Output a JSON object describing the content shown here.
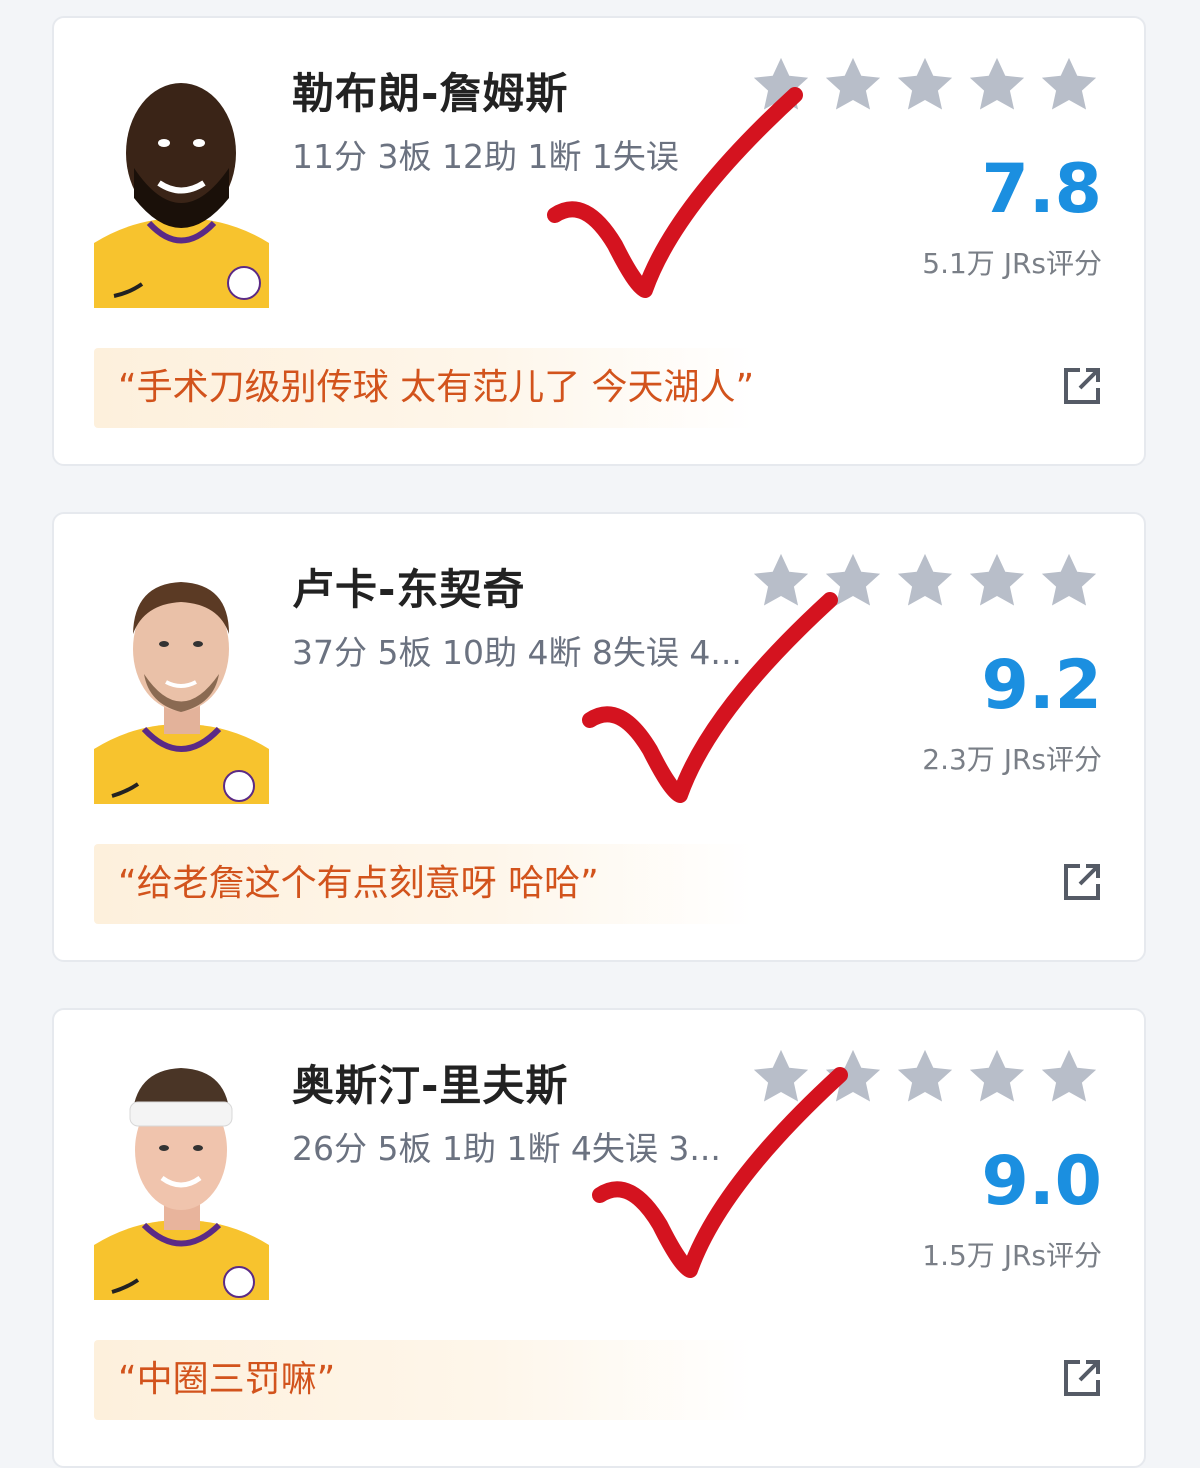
{
  "players": [
    {
      "name": "勒布朗-詹姆斯",
      "stats": "11分 3板 12助 1断 1失误",
      "score": "7.8",
      "rating_count": "5.1万 JRs评分",
      "comment": "“手术刀级别传球 太有范儿了 今天湖人”"
    },
    {
      "name": "卢卡-东契奇",
      "stats": "37分 5板 10助 4断 8失误 4...",
      "score": "9.2",
      "rating_count": "2.3万 JRs评分",
      "comment": "“给老詹这个有点刻意呀 哈哈”"
    },
    {
      "name": "奥斯汀-里夫斯",
      "stats": "26分 5板 1助 1断 4失误 3...",
      "score": "9.0",
      "rating_count": "1.5万 JRs评分",
      "comment": "“中圈三罚嘛”"
    }
  ],
  "colors": {
    "score": "#1b8fe0",
    "comment_text": "#d2531c",
    "star": "#b8bec9",
    "check_mark": "#d4131f",
    "jersey": "#f7c32e"
  }
}
